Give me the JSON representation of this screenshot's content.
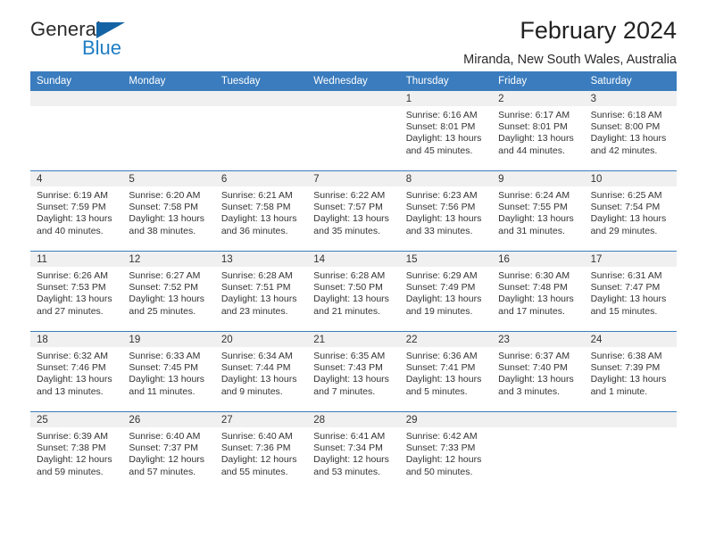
{
  "brand": {
    "line1": "General",
    "line2": "Blue",
    "triangle_color": "#1464a5",
    "blue_text_color": "#1f7dc4"
  },
  "header": {
    "title": "February 2024",
    "subtitle": "Miranda, New South Wales, Australia"
  },
  "calendar": {
    "header_bg": "#3a7cbe",
    "date_band_bg": "#f0f0f0",
    "weekdays": [
      "Sunday",
      "Monday",
      "Tuesday",
      "Wednesday",
      "Thursday",
      "Friday",
      "Saturday"
    ],
    "weeks": [
      [
        {
          "date": "",
          "sunrise": "",
          "sunset": "",
          "daylight_line1": "",
          "daylight_line2": ""
        },
        {
          "date": "",
          "sunrise": "",
          "sunset": "",
          "daylight_line1": "",
          "daylight_line2": ""
        },
        {
          "date": "",
          "sunrise": "",
          "sunset": "",
          "daylight_line1": "",
          "daylight_line2": ""
        },
        {
          "date": "",
          "sunrise": "",
          "sunset": "",
          "daylight_line1": "",
          "daylight_line2": ""
        },
        {
          "date": "1",
          "sunrise": "Sunrise: 6:16 AM",
          "sunset": "Sunset: 8:01 PM",
          "daylight_line1": "Daylight: 13 hours",
          "daylight_line2": "and 45 minutes."
        },
        {
          "date": "2",
          "sunrise": "Sunrise: 6:17 AM",
          "sunset": "Sunset: 8:01 PM",
          "daylight_line1": "Daylight: 13 hours",
          "daylight_line2": "and 44 minutes."
        },
        {
          "date": "3",
          "sunrise": "Sunrise: 6:18 AM",
          "sunset": "Sunset: 8:00 PM",
          "daylight_line1": "Daylight: 13 hours",
          "daylight_line2": "and 42 minutes."
        }
      ],
      [
        {
          "date": "4",
          "sunrise": "Sunrise: 6:19 AM",
          "sunset": "Sunset: 7:59 PM",
          "daylight_line1": "Daylight: 13 hours",
          "daylight_line2": "and 40 minutes."
        },
        {
          "date": "5",
          "sunrise": "Sunrise: 6:20 AM",
          "sunset": "Sunset: 7:58 PM",
          "daylight_line1": "Daylight: 13 hours",
          "daylight_line2": "and 38 minutes."
        },
        {
          "date": "6",
          "sunrise": "Sunrise: 6:21 AM",
          "sunset": "Sunset: 7:58 PM",
          "daylight_line1": "Daylight: 13 hours",
          "daylight_line2": "and 36 minutes."
        },
        {
          "date": "7",
          "sunrise": "Sunrise: 6:22 AM",
          "sunset": "Sunset: 7:57 PM",
          "daylight_line1": "Daylight: 13 hours",
          "daylight_line2": "and 35 minutes."
        },
        {
          "date": "8",
          "sunrise": "Sunrise: 6:23 AM",
          "sunset": "Sunset: 7:56 PM",
          "daylight_line1": "Daylight: 13 hours",
          "daylight_line2": "and 33 minutes."
        },
        {
          "date": "9",
          "sunrise": "Sunrise: 6:24 AM",
          "sunset": "Sunset: 7:55 PM",
          "daylight_line1": "Daylight: 13 hours",
          "daylight_line2": "and 31 minutes."
        },
        {
          "date": "10",
          "sunrise": "Sunrise: 6:25 AM",
          "sunset": "Sunset: 7:54 PM",
          "daylight_line1": "Daylight: 13 hours",
          "daylight_line2": "and 29 minutes."
        }
      ],
      [
        {
          "date": "11",
          "sunrise": "Sunrise: 6:26 AM",
          "sunset": "Sunset: 7:53 PM",
          "daylight_line1": "Daylight: 13 hours",
          "daylight_line2": "and 27 minutes."
        },
        {
          "date": "12",
          "sunrise": "Sunrise: 6:27 AM",
          "sunset": "Sunset: 7:52 PM",
          "daylight_line1": "Daylight: 13 hours",
          "daylight_line2": "and 25 minutes."
        },
        {
          "date": "13",
          "sunrise": "Sunrise: 6:28 AM",
          "sunset": "Sunset: 7:51 PM",
          "daylight_line1": "Daylight: 13 hours",
          "daylight_line2": "and 23 minutes."
        },
        {
          "date": "14",
          "sunrise": "Sunrise: 6:28 AM",
          "sunset": "Sunset: 7:50 PM",
          "daylight_line1": "Daylight: 13 hours",
          "daylight_line2": "and 21 minutes."
        },
        {
          "date": "15",
          "sunrise": "Sunrise: 6:29 AM",
          "sunset": "Sunset: 7:49 PM",
          "daylight_line1": "Daylight: 13 hours",
          "daylight_line2": "and 19 minutes."
        },
        {
          "date": "16",
          "sunrise": "Sunrise: 6:30 AM",
          "sunset": "Sunset: 7:48 PM",
          "daylight_line1": "Daylight: 13 hours",
          "daylight_line2": "and 17 minutes."
        },
        {
          "date": "17",
          "sunrise": "Sunrise: 6:31 AM",
          "sunset": "Sunset: 7:47 PM",
          "daylight_line1": "Daylight: 13 hours",
          "daylight_line2": "and 15 minutes."
        }
      ],
      [
        {
          "date": "18",
          "sunrise": "Sunrise: 6:32 AM",
          "sunset": "Sunset: 7:46 PM",
          "daylight_line1": "Daylight: 13 hours",
          "daylight_line2": "and 13 minutes."
        },
        {
          "date": "19",
          "sunrise": "Sunrise: 6:33 AM",
          "sunset": "Sunset: 7:45 PM",
          "daylight_line1": "Daylight: 13 hours",
          "daylight_line2": "and 11 minutes."
        },
        {
          "date": "20",
          "sunrise": "Sunrise: 6:34 AM",
          "sunset": "Sunset: 7:44 PM",
          "daylight_line1": "Daylight: 13 hours",
          "daylight_line2": "and 9 minutes."
        },
        {
          "date": "21",
          "sunrise": "Sunrise: 6:35 AM",
          "sunset": "Sunset: 7:43 PM",
          "daylight_line1": "Daylight: 13 hours",
          "daylight_line2": "and 7 minutes."
        },
        {
          "date": "22",
          "sunrise": "Sunrise: 6:36 AM",
          "sunset": "Sunset: 7:41 PM",
          "daylight_line1": "Daylight: 13 hours",
          "daylight_line2": "and 5 minutes."
        },
        {
          "date": "23",
          "sunrise": "Sunrise: 6:37 AM",
          "sunset": "Sunset: 7:40 PM",
          "daylight_line1": "Daylight: 13 hours",
          "daylight_line2": "and 3 minutes."
        },
        {
          "date": "24",
          "sunrise": "Sunrise: 6:38 AM",
          "sunset": "Sunset: 7:39 PM",
          "daylight_line1": "Daylight: 13 hours",
          "daylight_line2": "and 1 minute."
        }
      ],
      [
        {
          "date": "25",
          "sunrise": "Sunrise: 6:39 AM",
          "sunset": "Sunset: 7:38 PM",
          "daylight_line1": "Daylight: 12 hours",
          "daylight_line2": "and 59 minutes."
        },
        {
          "date": "26",
          "sunrise": "Sunrise: 6:40 AM",
          "sunset": "Sunset: 7:37 PM",
          "daylight_line1": "Daylight: 12 hours",
          "daylight_line2": "and 57 minutes."
        },
        {
          "date": "27",
          "sunrise": "Sunrise: 6:40 AM",
          "sunset": "Sunset: 7:36 PM",
          "daylight_line1": "Daylight: 12 hours",
          "daylight_line2": "and 55 minutes."
        },
        {
          "date": "28",
          "sunrise": "Sunrise: 6:41 AM",
          "sunset": "Sunset: 7:34 PM",
          "daylight_line1": "Daylight: 12 hours",
          "daylight_line2": "and 53 minutes."
        },
        {
          "date": "29",
          "sunrise": "Sunrise: 6:42 AM",
          "sunset": "Sunset: 7:33 PM",
          "daylight_line1": "Daylight: 12 hours",
          "daylight_line2": "and 50 minutes."
        },
        {
          "date": "",
          "sunrise": "",
          "sunset": "",
          "daylight_line1": "",
          "daylight_line2": ""
        },
        {
          "date": "",
          "sunrise": "",
          "sunset": "",
          "daylight_line1": "",
          "daylight_line2": ""
        }
      ]
    ]
  }
}
